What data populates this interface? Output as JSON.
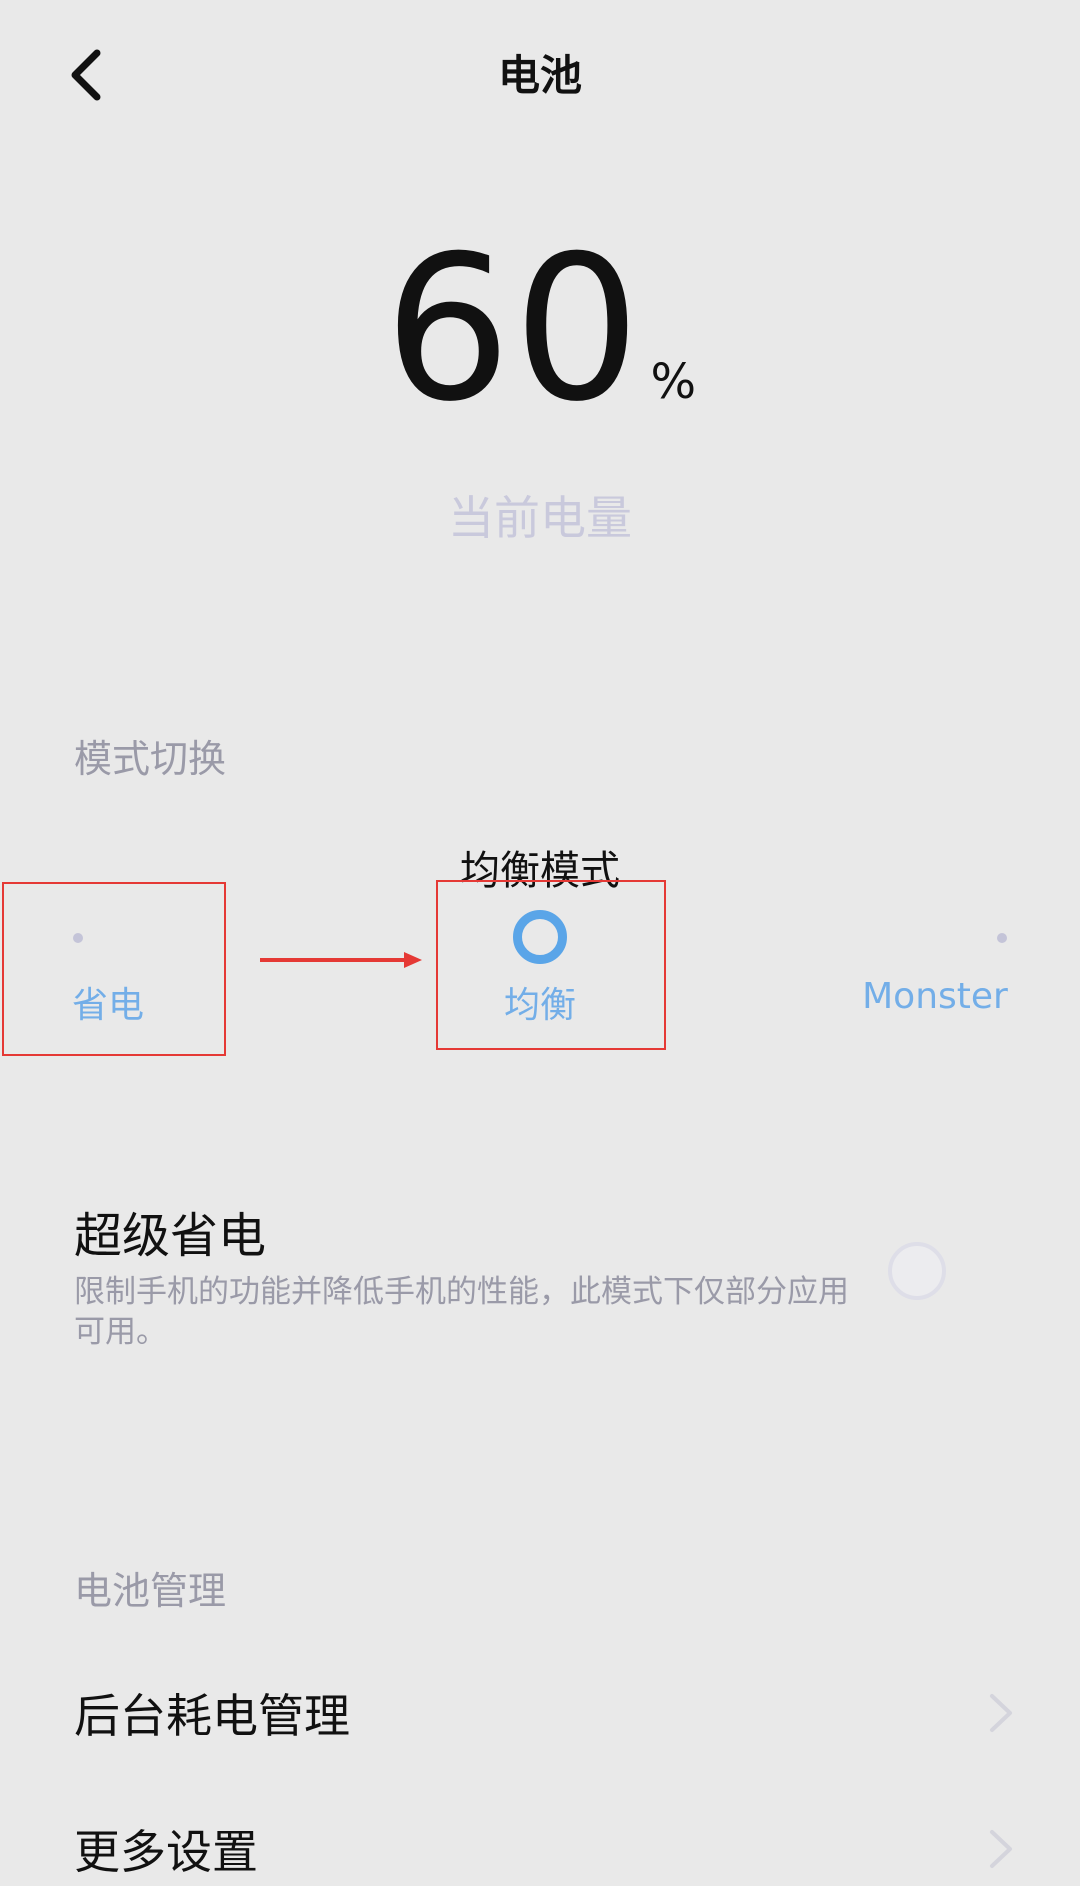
{
  "header": {
    "title": "电池"
  },
  "battery": {
    "level": "60",
    "unit": "%",
    "caption": "当前电量"
  },
  "mode_section": {
    "heading": "模式切换",
    "current_mode": "均衡模式",
    "options": [
      {
        "label": "省电",
        "selected": false
      },
      {
        "label": "均衡",
        "selected": true
      },
      {
        "label": "Monster",
        "selected": false
      }
    ]
  },
  "super_saver": {
    "title": "超级省电",
    "description": "限制手机的功能并降低手机的性能，此模式下仅部分应用可用。",
    "enabled": false
  },
  "battery_mgmt": {
    "heading": "电池管理",
    "items": [
      {
        "label": "后台耗电管理"
      },
      {
        "label": "更多设置"
      }
    ]
  },
  "colors": {
    "accent": "#5aa5e8",
    "annotation": "#e53935",
    "background": "#e9e9e9"
  }
}
